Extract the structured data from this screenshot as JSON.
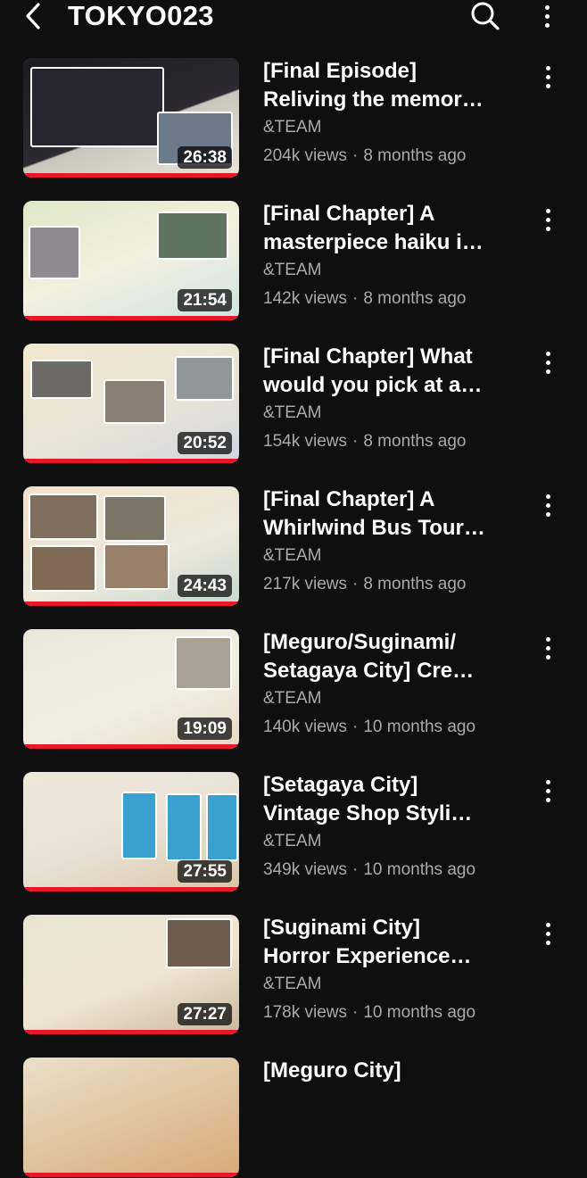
{
  "header": {
    "title": "TOKYO023",
    "back_icon": "arrow-left-icon",
    "search_icon": "search-icon",
    "more_icon": "more-vertical-icon"
  },
  "videos": [
    {
      "title_line1": "[Final Episode]",
      "title_line2": "Reliving the memor…",
      "channel": "&TEAM",
      "views": "204k views",
      "age": "8 months ago",
      "duration": "26:38"
    },
    {
      "title_line1": "[Final Chapter] A",
      "title_line2": "masterpiece haiku i…",
      "channel": "&TEAM",
      "views": "142k views",
      "age": "8 months ago",
      "duration": "21:54"
    },
    {
      "title_line1": "[Final Chapter] What",
      "title_line2": "would you pick at a…",
      "channel": "&TEAM",
      "views": "154k views",
      "age": "8 months ago",
      "duration": "20:52"
    },
    {
      "title_line1": "[Final Chapter] A",
      "title_line2": "Whirlwind Bus Tour…",
      "channel": "&TEAM",
      "views": "217k views",
      "age": "8 months ago",
      "duration": "24:43"
    },
    {
      "title_line1": "[Meguro/Suginami/",
      "title_line2": "Setagaya City] Cre…",
      "channel": "&TEAM",
      "views": "140k views",
      "age": "10 months ago",
      "duration": "19:09"
    },
    {
      "title_line1": "[Setagaya City]",
      "title_line2": "Vintage Shop Styli…",
      "channel": "&TEAM",
      "views": "349k views",
      "age": "10 months ago",
      "duration": "27:55"
    },
    {
      "title_line1": "[Suginami City]",
      "title_line2": "Horror Experience…",
      "channel": "&TEAM",
      "views": "178k views",
      "age": "10 months ago",
      "duration": "27:27"
    },
    {
      "title_line1": "[Meguro City]",
      "title_line2": "",
      "channel": "",
      "views": "",
      "age": "",
      "duration": ""
    }
  ],
  "separator": "·",
  "colors": {
    "background": "#0f0f0f",
    "text_primary": "#ffffff",
    "text_secondary": "#aaaaaa",
    "progress_red": "#e5192a"
  }
}
